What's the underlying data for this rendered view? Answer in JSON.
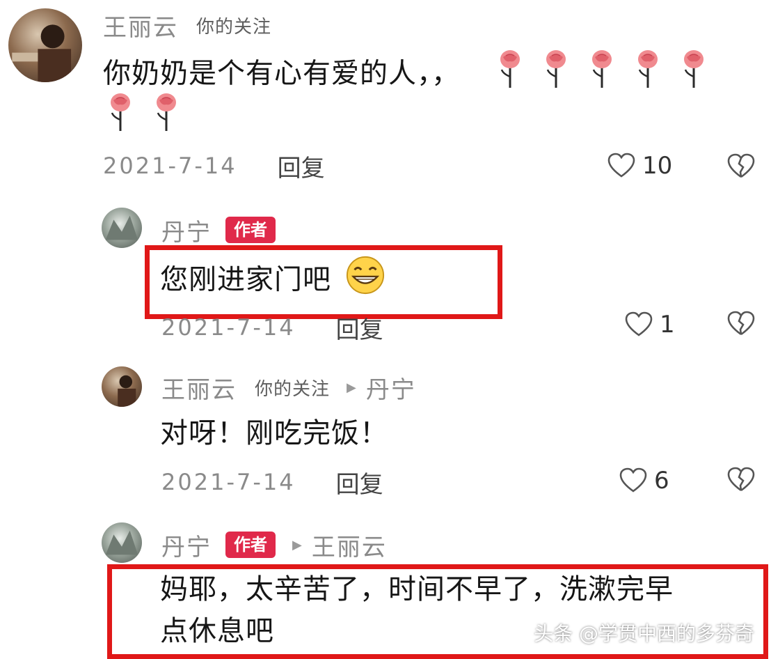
{
  "comments": [
    {
      "username": "王丽云",
      "follow_tag": "你的关注",
      "text": "你奶奶是个有心有爱的人，，",
      "emoji": "rose-emoji",
      "date": "2021-7-14",
      "reply_label": "回复",
      "likes": "10"
    },
    {
      "username": "丹宁",
      "badge": "作者",
      "text": "您刚进家门吧",
      "emoji": "grin-emoji",
      "date": "2021-7-14",
      "reply_label": "回复",
      "likes": "1"
    },
    {
      "username": "王丽云",
      "follow_tag": "你的关注",
      "reply_to": "丹宁",
      "text": "对呀！刚吃完饭！",
      "date": "2021-7-14",
      "reply_label": "回复",
      "likes": "6"
    },
    {
      "username": "丹宁",
      "badge": "作者",
      "reply_to": "王丽云",
      "text_line1": "妈耶，太辛苦了，时间不早了，洗漱完早",
      "text_line2": "点休息吧"
    }
  ],
  "watermark": "头条 @学贯中西的多芬奇",
  "colors": {
    "author_badge": "#e0294a",
    "highlight_box": "#e01818"
  }
}
